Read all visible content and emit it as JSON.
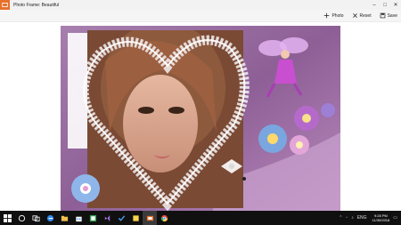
{
  "window": {
    "title": "Photo Frame: Beautiful"
  },
  "toolbar": {
    "photo_label": "Photo",
    "reset_label": "Reset",
    "save_label": "Save"
  },
  "taskbar": {
    "language": "ENG",
    "time": "9:28 PM",
    "date": "11/30/2018"
  },
  "colors": {
    "app_accent": "#e8702a",
    "taskbar": "#101010",
    "frame_purple": "#9a6fa0"
  }
}
